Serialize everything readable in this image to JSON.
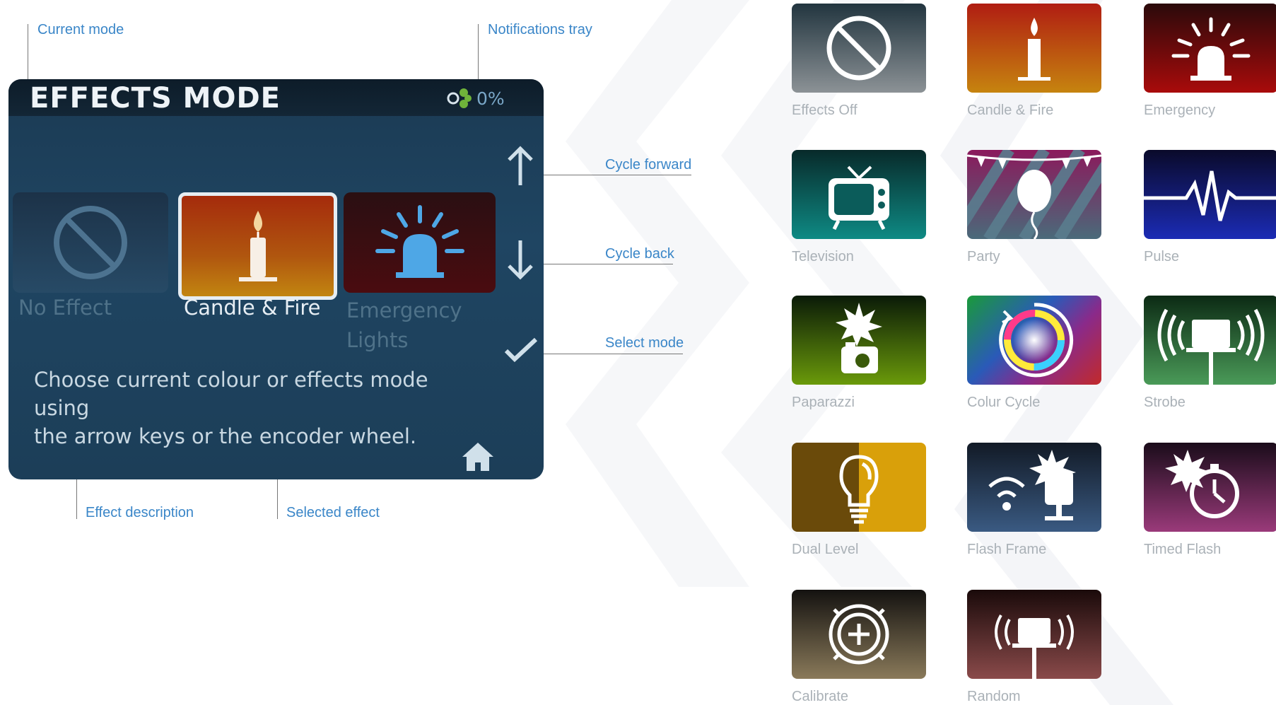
{
  "screen": {
    "title": "EFFECTS MODE",
    "tray_percent": "0%",
    "effects": [
      {
        "label": "No Effect",
        "state": "inactive"
      },
      {
        "label": "Candle & Fire",
        "state": "selected"
      },
      {
        "label_line1": "Emergency",
        "label_line2": "Lights",
        "state": "inactive"
      }
    ],
    "description_line1": "Choose current colour or effects mode using",
    "description_line2": "the arrow keys or the encoder wheel."
  },
  "callouts": {
    "current_mode": "Current mode",
    "notifications_tray": "Notifications tray",
    "cycle_forward": "Cycle forward",
    "cycle_back": "Cycle back",
    "select_mode": "Select mode",
    "effect_description": "Effect description",
    "selected_effect": "Selected effect"
  },
  "effects_grid": [
    {
      "label": "Effects Off",
      "icon": "no-entry-icon",
      "color_top": "#22353f",
      "color_bottom": "#8c9296"
    },
    {
      "label": "Candle & Fire",
      "icon": "candle-icon",
      "color_top": "#b01d12",
      "color_bottom": "#c6840f"
    },
    {
      "label": "Emergency",
      "icon": "siren-icon",
      "color_top": "#2a0a0b",
      "color_bottom": "#a90b0b"
    },
    {
      "label": "Television",
      "icon": "tv-icon",
      "color_top": "#082a2a",
      "color_bottom": "#0e8a84"
    },
    {
      "label": "Party",
      "icon": "balloon-icon",
      "color_top": "#8b1a5c",
      "color_bottom": "#4a6a7a"
    },
    {
      "label": "Pulse",
      "icon": "pulse-icon",
      "color_top": "#0a0a2a",
      "color_bottom": "#1b2bb5"
    },
    {
      "label": "Paparazzi",
      "icon": "camera-flash-icon",
      "color_top": "#0a1a08",
      "color_bottom": "#6a9a0a"
    },
    {
      "label": "Colur Cycle",
      "icon": "color-wheel-icon",
      "color_top": "#2a8a3a",
      "color_bottom": "#c22a2a"
    },
    {
      "label": "Strobe",
      "icon": "strobe-icon",
      "color_top": "#0c2a14",
      "color_bottom": "#4a9a58"
    },
    {
      "label": "Dual Level",
      "icon": "bulb-icon",
      "color_top": "#6a4a0a",
      "color_bottom": "#d9a00a"
    },
    {
      "label": "Flash Frame",
      "icon": "flash-frame-icon",
      "color_top": "#121a26",
      "color_bottom": "#3a5a82"
    },
    {
      "label": "Timed Flash",
      "icon": "timer-flash-icon",
      "color_top": "#1a0c1a",
      "color_bottom": "#9a3a7a"
    },
    {
      "label": "Calibrate",
      "icon": "calibrate-icon",
      "color_top": "#141210",
      "color_bottom": "#8a7a5a"
    },
    {
      "label": "Random",
      "icon": "random-icon",
      "color_top": "#1a0a0a",
      "color_bottom": "#8a4a4a"
    }
  ]
}
